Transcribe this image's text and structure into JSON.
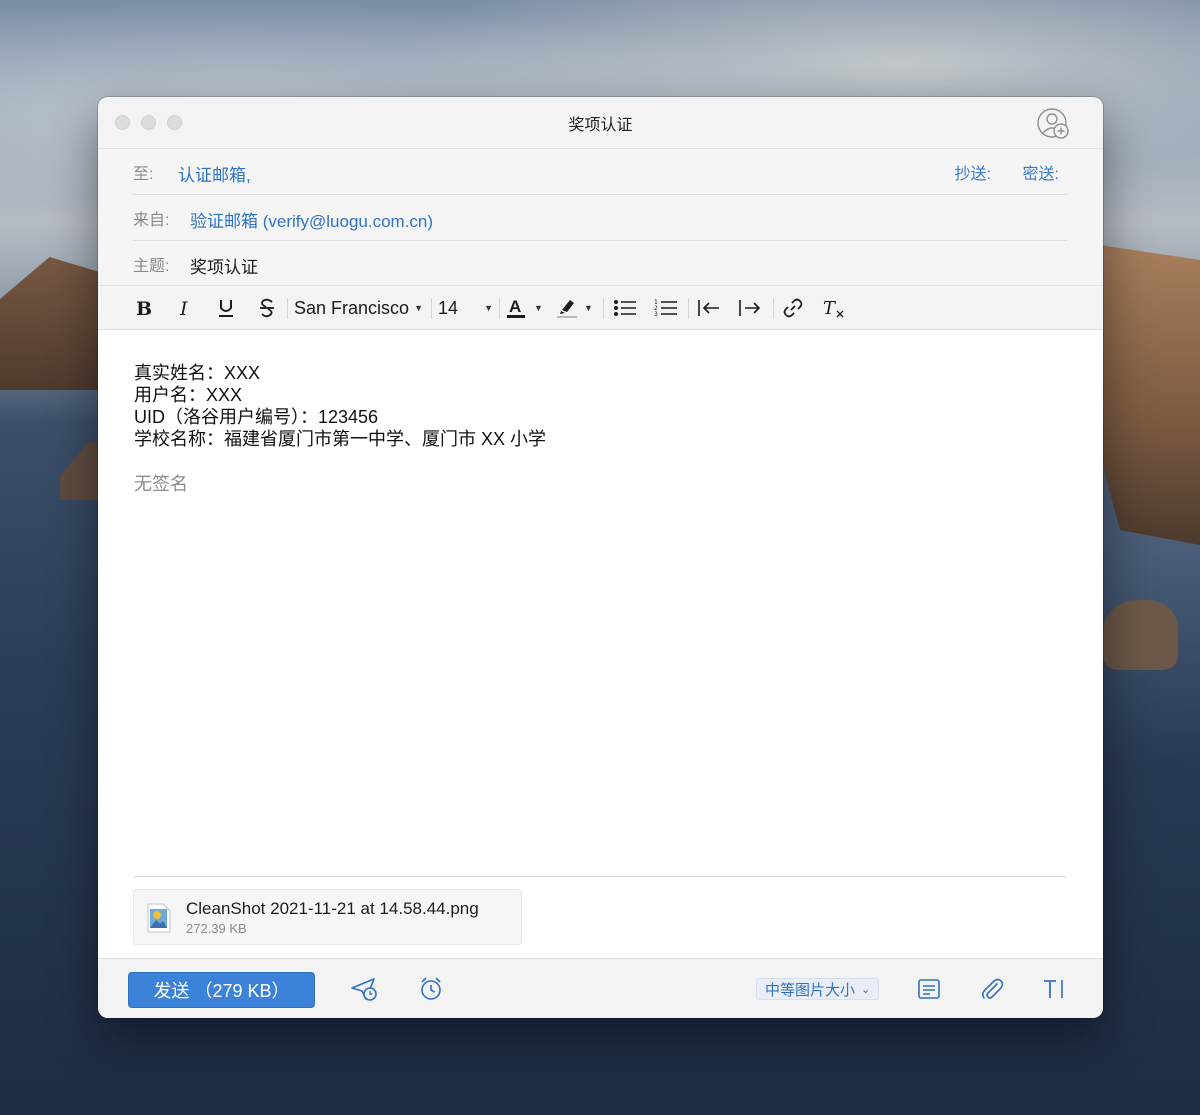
{
  "window": {
    "title": "奖项认证"
  },
  "header": {
    "to_label": "至:",
    "to_value": "认证邮箱,",
    "cc_label": "抄送:",
    "bcc_label": "密送:",
    "from_label": "来自:",
    "from_value": "验证邮箱 (verify@luogu.com.cn)",
    "subject_label": "主题:",
    "subject_value": "奖项认证"
  },
  "toolbar": {
    "font_family": "San Francisco",
    "font_size": "14",
    "icons": [
      "bold-icon",
      "italic-icon",
      "underline-icon",
      "strikethrough-icon",
      "font-family-dropdown",
      "font-size-dropdown",
      "text-color-icon",
      "highlight-icon",
      "bullet-list-icon",
      "numbered-list-icon",
      "outdent-icon",
      "indent-icon",
      "link-icon",
      "clear-format-icon"
    ]
  },
  "body": {
    "lines": [
      "真实姓名：XXX",
      "用户名：XXX",
      "UID（洛谷用户编号）：123456",
      "学校名称：福建省厦门市第一中学、厦门市 XX 小学"
    ],
    "signature": "无签名"
  },
  "attachment": {
    "name": "CleanShot 2021-11-21 at 14.58.44.png",
    "size": "272.39 KB"
  },
  "bottombar": {
    "send_label": "发送  （279 KB）",
    "image_size_label": "中等图片大小",
    "icons": [
      "send-later-icon",
      "reminder-icon",
      "template-icon",
      "attach-icon",
      "text-format-icon"
    ]
  },
  "colors": {
    "accent": "#3c82d8",
    "link": "#2f73c5"
  }
}
